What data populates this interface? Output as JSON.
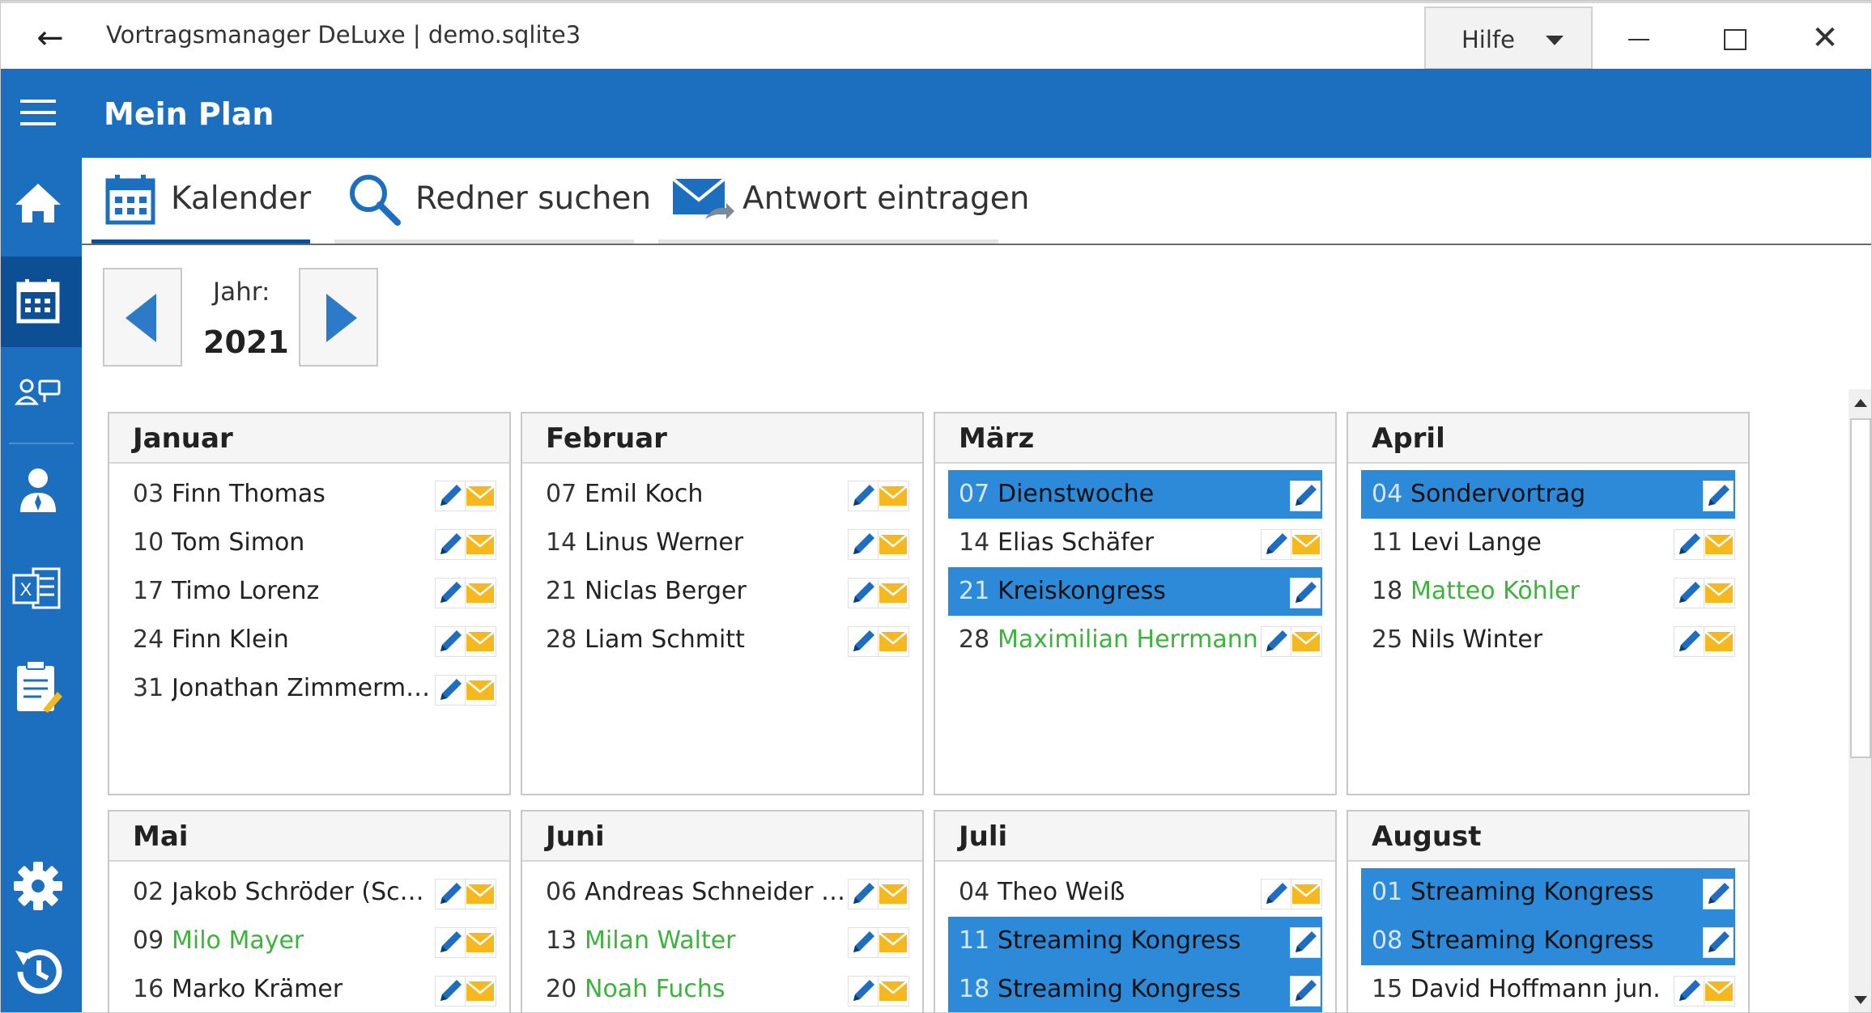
{
  "window": {
    "title": "Vortragsmanager DeLuxe | demo.sqlite3",
    "help_label": "Hilfe"
  },
  "header": {
    "title": "Mein Plan"
  },
  "tabs": [
    {
      "label": "Kalender",
      "icon": "calendar-icon",
      "active": true
    },
    {
      "label": "Redner suchen",
      "icon": "search-icon",
      "active": false
    },
    {
      "label": "Antwort eintragen",
      "icon": "mail-reply-icon",
      "active": false
    }
  ],
  "year_nav": {
    "label": "Jahr:",
    "value": "2021"
  },
  "sidebar": [
    {
      "name": "home",
      "icon": "home-icon"
    },
    {
      "name": "calendar",
      "icon": "calendar-icon",
      "active": true
    },
    {
      "name": "speakers",
      "icon": "people-talk-icon"
    },
    {
      "name": "person",
      "icon": "person-icon"
    },
    {
      "name": "excel",
      "icon": "excel-icon"
    },
    {
      "name": "clipboard",
      "icon": "clipboard-icon"
    },
    {
      "name": "settings",
      "icon": "gear-icon"
    },
    {
      "name": "history",
      "icon": "history-icon"
    }
  ],
  "colors": {
    "accent": "#1b6fbe",
    "sidebar_active": "#0d4f94",
    "special_row": "#2d8ad8",
    "green_text": "#3cb43c",
    "mail_yellow": "#f6b81f",
    "pencil_blue": "#1f6dbf"
  },
  "months": [
    {
      "name": "Januar",
      "entries": [
        {
          "day": "03",
          "name": "Finn Thomas",
          "type": "talk",
          "green": false
        },
        {
          "day": "10",
          "name": "Tom Simon",
          "type": "talk",
          "green": false
        },
        {
          "day": "17",
          "name": "Timo Lorenz",
          "type": "talk",
          "green": false
        },
        {
          "day": "24",
          "name": "Finn Klein",
          "type": "talk",
          "green": false
        },
        {
          "day": "31",
          "name": "Jonathan Zimmermann",
          "type": "talk",
          "green": false
        }
      ]
    },
    {
      "name": "Februar",
      "entries": [
        {
          "day": "07",
          "name": "Emil Koch",
          "type": "talk",
          "green": false
        },
        {
          "day": "14",
          "name": "Linus Werner",
          "type": "talk",
          "green": false
        },
        {
          "day": "21",
          "name": "Niclas Berger",
          "type": "talk",
          "green": false
        },
        {
          "day": "28",
          "name": "Liam Schmitt",
          "type": "talk",
          "green": false
        }
      ]
    },
    {
      "name": "März",
      "entries": [
        {
          "day": "07",
          "name": "Dienstwoche",
          "type": "special",
          "green": false
        },
        {
          "day": "14",
          "name": "Elias Schäfer",
          "type": "talk",
          "green": false
        },
        {
          "day": "21",
          "name": "Kreiskongress",
          "type": "special",
          "green": false
        },
        {
          "day": "28",
          "name": "Maximilian Herrmann",
          "type": "talk",
          "green": true
        }
      ]
    },
    {
      "name": "April",
      "entries": [
        {
          "day": "04",
          "name": "Sondervortrag",
          "type": "special",
          "green": false
        },
        {
          "day": "11",
          "name": "Levi Lange",
          "type": "talk",
          "green": false
        },
        {
          "day": "18",
          "name": "Matteo Köhler",
          "type": "talk",
          "green": true
        },
        {
          "day": "25",
          "name": "Nils Winter",
          "type": "talk",
          "green": false
        }
      ]
    },
    {
      "name": "Mai",
      "entries": [
        {
          "day": "02",
          "name": "Jakob Schröder (Schne...",
          "type": "talk",
          "green": false
        },
        {
          "day": "09",
          "name": "Milo Mayer",
          "type": "talk",
          "green": true
        },
        {
          "day": "16",
          "name": "Marko Krämer",
          "type": "talk",
          "green": false
        }
      ]
    },
    {
      "name": "Juni",
      "entries": [
        {
          "day": "06",
          "name": "Andreas Schneider jun.",
          "type": "talk",
          "green": false
        },
        {
          "day": "13",
          "name": "Milan Walter",
          "type": "talk",
          "green": true
        },
        {
          "day": "20",
          "name": "Noah Fuchs",
          "type": "talk",
          "green": true
        }
      ]
    },
    {
      "name": "Juli",
      "entries": [
        {
          "day": "04",
          "name": "Theo Weiß",
          "type": "talk",
          "green": false
        },
        {
          "day": "11",
          "name": "Streaming Kongress",
          "type": "special",
          "green": false
        },
        {
          "day": "18",
          "name": "Streaming Kongress",
          "type": "special",
          "green": false
        }
      ]
    },
    {
      "name": "August",
      "entries": [
        {
          "day": "01",
          "name": "Streaming Kongress",
          "type": "special",
          "green": false
        },
        {
          "day": "08",
          "name": "Streaming Kongress",
          "type": "special",
          "green": false
        },
        {
          "day": "15",
          "name": "David Hoffmann jun.",
          "type": "talk",
          "green": false
        }
      ]
    }
  ]
}
